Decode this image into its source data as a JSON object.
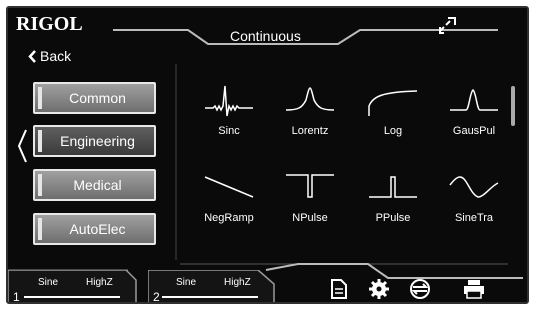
{
  "header": {
    "brand": "RIGOL",
    "mode": "Continuous"
  },
  "nav": {
    "back_label": "Back"
  },
  "categories": [
    {
      "label": "Common",
      "selected": false
    },
    {
      "label": "Engineering",
      "selected": true
    },
    {
      "label": "Medical",
      "selected": false
    },
    {
      "label": "AutoElec",
      "selected": false
    }
  ],
  "waveforms": [
    {
      "label": "Sinc",
      "icon": "sinc-wave-icon"
    },
    {
      "label": "Lorentz",
      "icon": "lorentz-wave-icon"
    },
    {
      "label": "Log",
      "icon": "log-wave-icon"
    },
    {
      "label": "GausPul",
      "icon": "gauss-pulse-wave-icon"
    },
    {
      "label": "NegRamp",
      "icon": "negramp-wave-icon"
    },
    {
      "label": "NPulse",
      "icon": "npulse-wave-icon"
    },
    {
      "label": "PPulse",
      "icon": "ppulse-wave-icon"
    },
    {
      "label": "SineTra",
      "icon": "sinetra-wave-icon"
    }
  ],
  "channels": [
    {
      "number": "1",
      "wave": "Sine",
      "impedance": "HighZ"
    },
    {
      "number": "2",
      "wave": "Sine",
      "impedance": "HighZ"
    }
  ],
  "colors": {
    "background": "#0a0a0a",
    "foreground": "#ffffff",
    "button_inactive": "#8a8a8a",
    "button_active": "#4a4a4a"
  }
}
